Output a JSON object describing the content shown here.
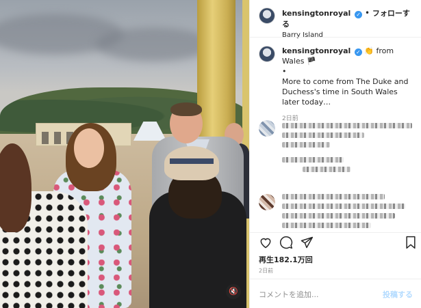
{
  "header": {
    "username": "kensingtonroyal",
    "separator": "•",
    "follow_label": "フォローする",
    "location": "Barry Island"
  },
  "caption": {
    "username": "kensingtonroyal",
    "headline": "👏 from Wales 🏴",
    "bullet": "•",
    "text": "More to come from The Duke and Duchess's time in South Wales later today…",
    "time": "2日前"
  },
  "stats": {
    "views": "再生182.1万回",
    "date": "2日前"
  },
  "comment_bar": {
    "placeholder": "コメントを追加...",
    "post_label": "投稿する"
  },
  "icons": {
    "verified": "verified-badge-icon",
    "like": "heart-icon",
    "comment": "comment-icon",
    "share": "paper-plane-icon",
    "save": "bookmark-icon",
    "mute": "speaker-muted-icon"
  },
  "colors": {
    "verified": "#3897f0",
    "post_button_disabled": "#b3dbff",
    "muted_text": "#8e8e8e"
  }
}
